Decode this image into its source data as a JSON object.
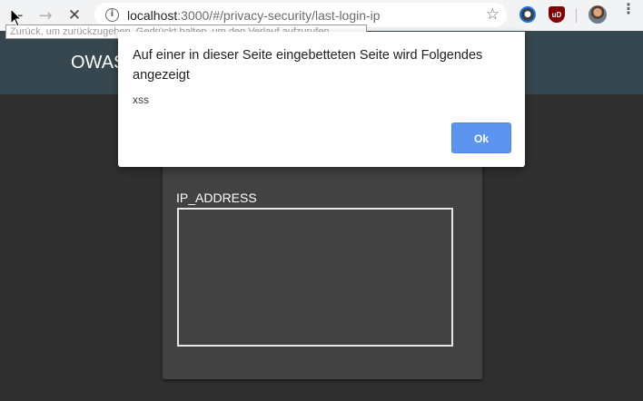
{
  "browser": {
    "url_host": "localhost",
    "url_rest": ":3000/#/privacy-security/last-login-ip",
    "icons": {
      "back": "arrow-back-icon",
      "forward": "arrow-forward-icon",
      "stop": "stop-loading-icon",
      "info": "site-info-icon",
      "star": "bookmark-star-icon",
      "menu": "kebab-menu-icon"
    },
    "tooltip": "Zurück, um zurückzugehen. Gedrückt halten, um den Verlauf aufzurufen"
  },
  "app": {
    "title": "OWAS",
    "toolbar_color": "#37474f"
  },
  "card": {
    "label": "IP_ADDRESS"
  },
  "dialog": {
    "title": "Auf einer in dieser Seite eingebetteten Seite wird Folgendes angezeigt",
    "message": "xss",
    "ok_label": "Ok",
    "accent": "#5b95ef"
  }
}
